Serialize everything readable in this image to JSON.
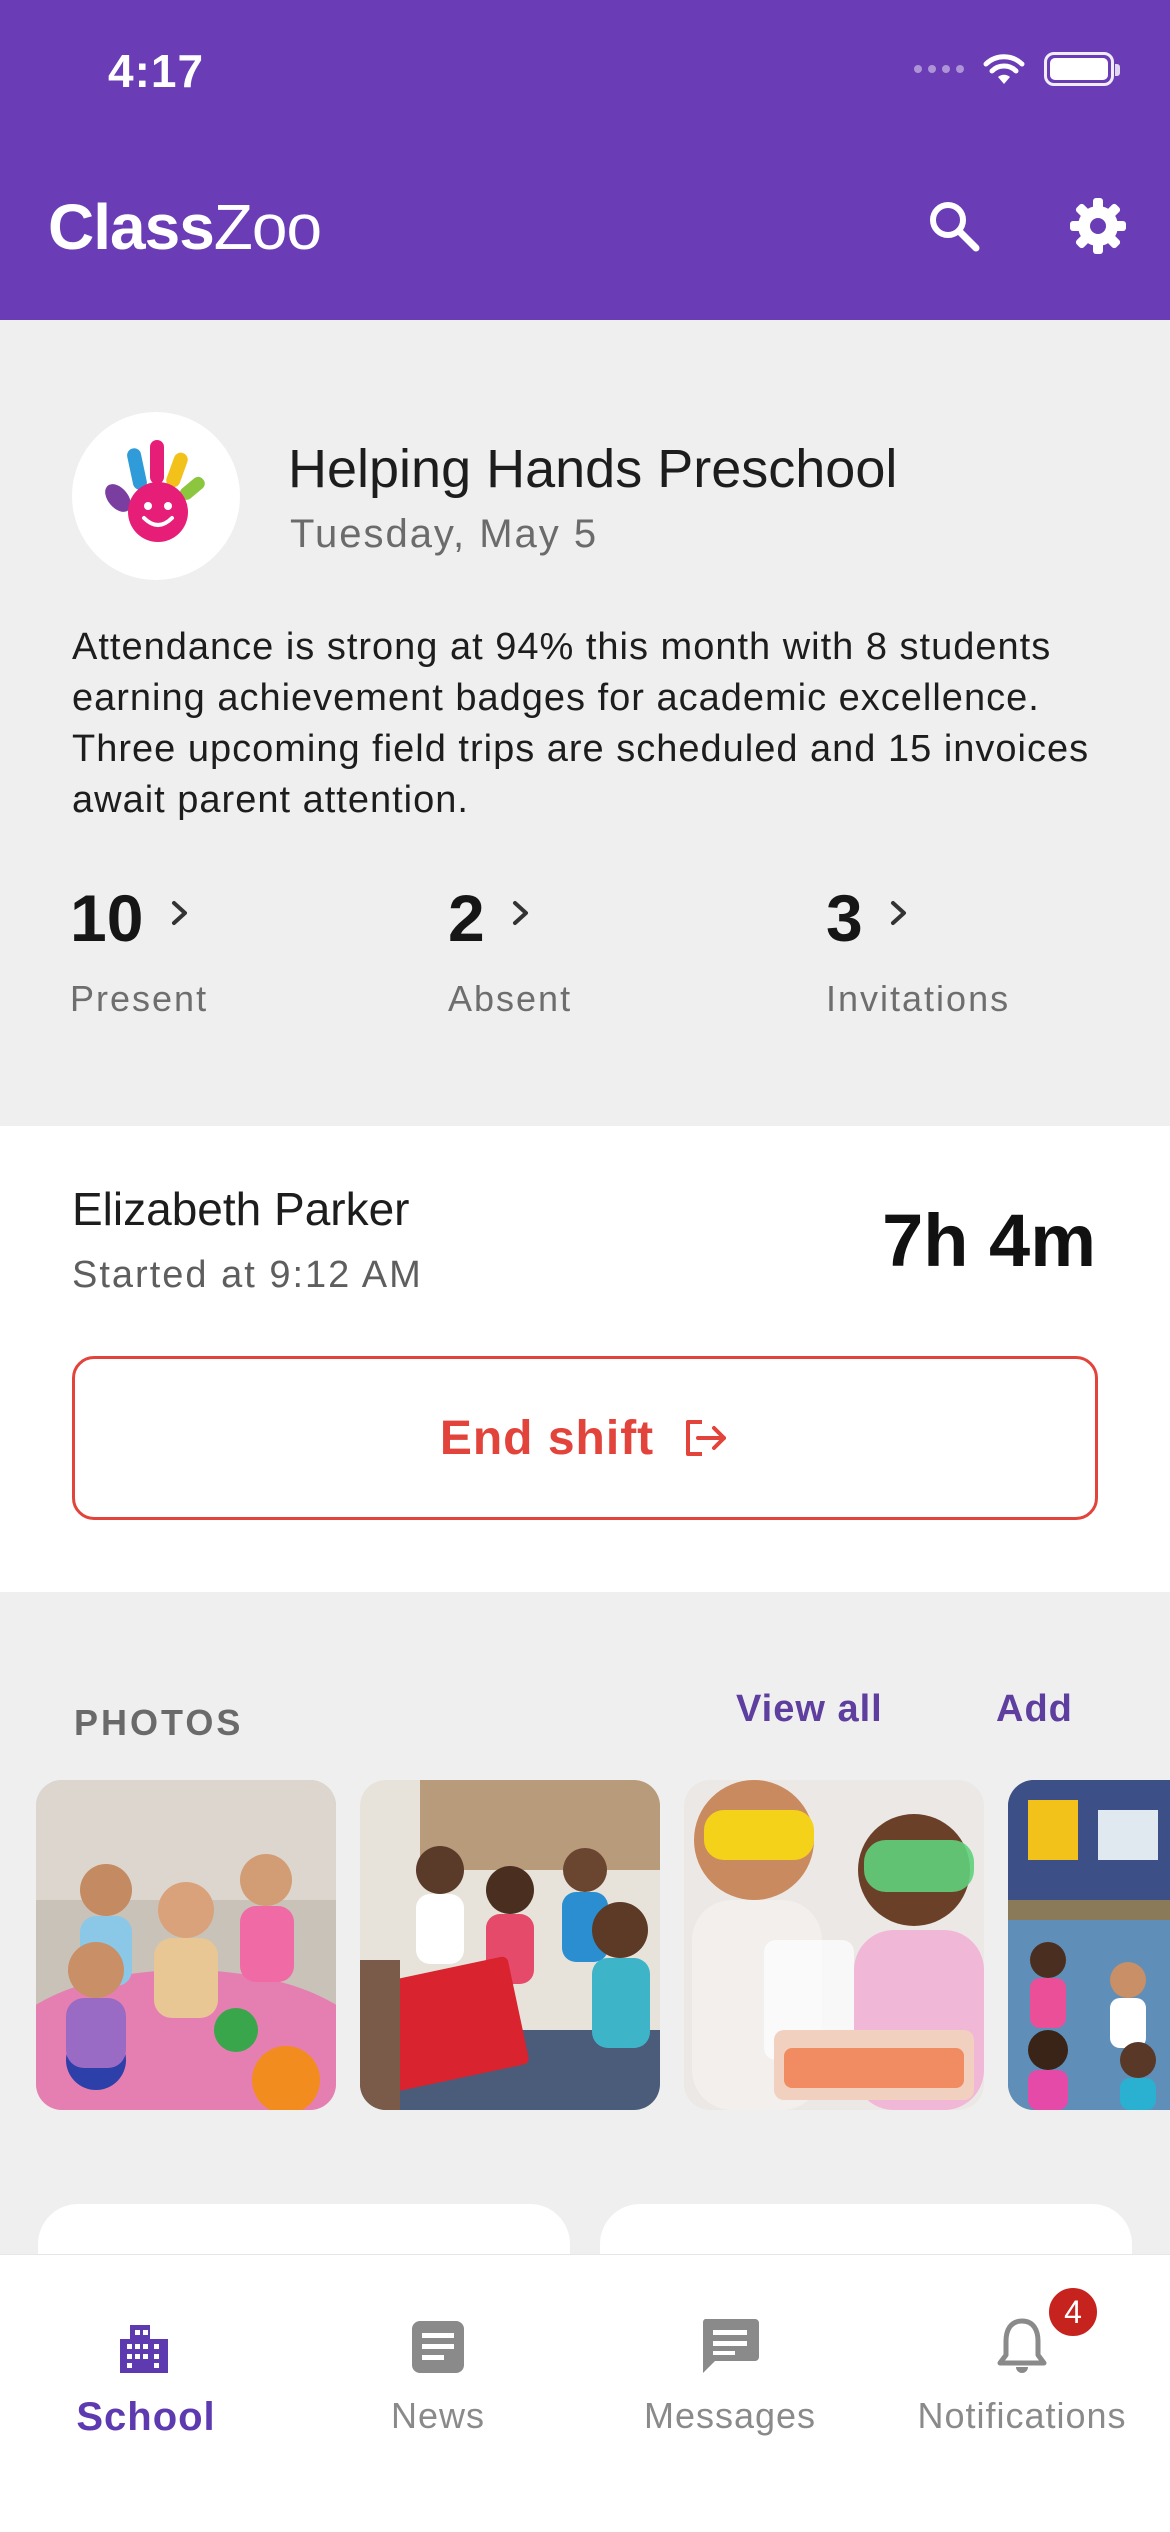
{
  "status_bar": {
    "time": "4:17"
  },
  "header": {
    "brand_bold": "Class",
    "brand_light": "Zoo",
    "icons": {
      "search": "search-icon",
      "settings": "gear-icon"
    },
    "background_color": "#6a3cb5"
  },
  "school": {
    "name": "Helping Hands Preschool",
    "date": "Tuesday, May 5",
    "summary": "Attendance is strong at 94% this month with 8 students earning achievement badges for academic excellence. Three upcoming field trips are scheduled and 15 invoices await parent attention.",
    "stats": [
      {
        "value": "10",
        "label": "Present"
      },
      {
        "value": "2",
        "label": "Absent"
      },
      {
        "value": "3",
        "label": "Invitations"
      }
    ]
  },
  "shift": {
    "staff_name": "Elizabeth Parker",
    "started_at": "Started at 9:12 AM",
    "duration": "7h 4m",
    "end_button_label": "End shift",
    "accent_color": "#e2433a"
  },
  "photos": {
    "title": "PHOTOS",
    "view_all_label": "View all",
    "add_label": "Add",
    "items": [
      {
        "icon": "photo-children-sitting"
      },
      {
        "icon": "photo-story-time"
      },
      {
        "icon": "photo-science-goggles"
      },
      {
        "icon": "photo-classroom-play"
      }
    ]
  },
  "tabbar": {
    "tabs": [
      {
        "label": "School",
        "icon": "school-building-icon",
        "active": true
      },
      {
        "label": "News",
        "icon": "news-icon",
        "active": false
      },
      {
        "label": "Messages",
        "icon": "message-icon",
        "active": false
      },
      {
        "label": "Notifications",
        "icon": "bell-icon",
        "active": false,
        "badge": "4"
      }
    ],
    "active_color": "#5d3ab0"
  }
}
